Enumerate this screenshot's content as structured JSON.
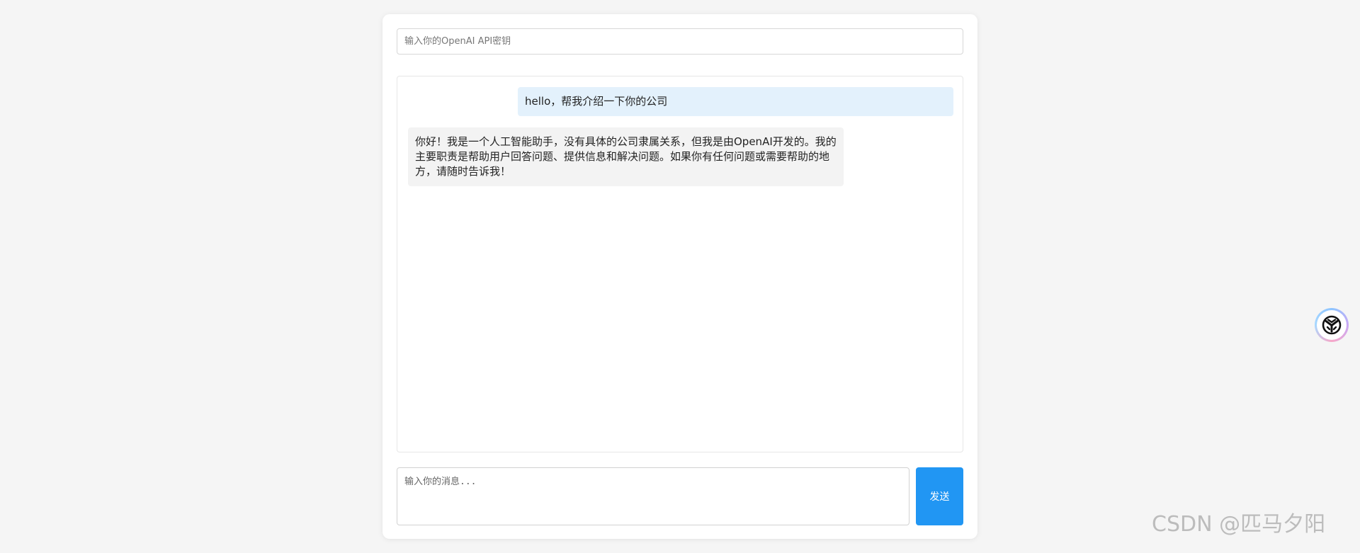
{
  "api_key": {
    "placeholder": "输入你的OpenAI API密钥",
    "value": ""
  },
  "chat": {
    "messages": [
      {
        "role": "user",
        "text": "hello，帮我介绍一下你的公司"
      },
      {
        "role": "assistant",
        "text": "你好！我是一个人工智能助手，没有具体的公司隶属关系，但我是由OpenAI开发的。我的主要职责是帮助用户回答问题、提供信息和解决问题。如果你有任何问题或需要帮助的地方，请随时告诉我！"
      }
    ]
  },
  "composer": {
    "placeholder": "输入你的消息...",
    "value": "",
    "send_label": "发送"
  },
  "floating_widget": {
    "icon": "assistant-logo-icon"
  },
  "watermark": "CSDN @匹马夕阳",
  "colors": {
    "page_background": "#f5f5f5",
    "user_bubble": "#e3f1fc",
    "assistant_bubble": "#f3f3f3",
    "send_button": "#2196f3"
  }
}
